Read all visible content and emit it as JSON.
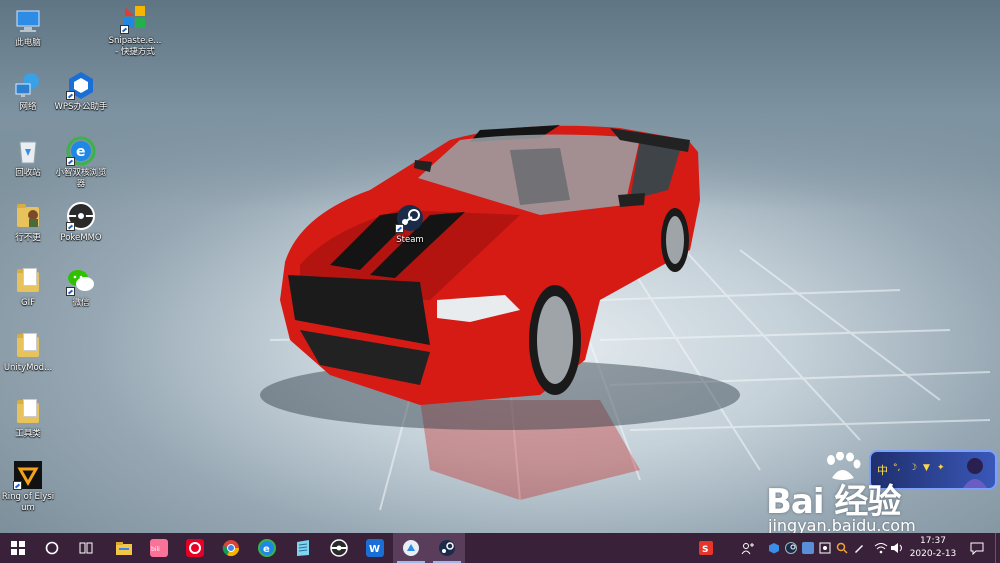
{
  "desktop": {
    "icons": [
      {
        "label": "此电脑",
        "icon": "computer-icon"
      },
      {
        "label": "Snipaste.e... - 快捷方式",
        "icon": "snipaste-icon"
      },
      {
        "label": "网络",
        "icon": "network-icon"
      },
      {
        "label": "WPS办公助手",
        "icon": "wps-assistant-icon"
      },
      {
        "label": "回收站",
        "icon": "recycle-bin-icon"
      },
      {
        "label": "小智双核浏览器",
        "icon": "browser-icon"
      },
      {
        "label": "行不更",
        "icon": "folder-icon"
      },
      {
        "label": "PokeMMO",
        "icon": "pokemmo-icon"
      },
      {
        "label": "GIF",
        "icon": "folder-icon"
      },
      {
        "label": "微信",
        "icon": "wechat-icon"
      },
      {
        "label": "UnityMod...",
        "icon": "folder-icon"
      },
      {
        "label": "Steam",
        "icon": "steam-icon"
      },
      {
        "label": "工具类",
        "icon": "folder-icon"
      },
      {
        "label": "Ring of Elysium",
        "icon": "ring-of-elysium-icon"
      }
    ]
  },
  "taskbar": {
    "apps": [
      {
        "icon": "start-icon"
      },
      {
        "icon": "cortana-search-icon"
      },
      {
        "icon": "task-view-icon"
      },
      {
        "icon": "file-explorer-icon"
      },
      {
        "icon": "bilibili-icon"
      },
      {
        "icon": "netease-music-icon"
      },
      {
        "icon": "chrome-icon"
      },
      {
        "icon": "browser-icon"
      },
      {
        "icon": "notepad-icon"
      },
      {
        "icon": "pokemmo-icon"
      },
      {
        "icon": "wps-icon"
      },
      {
        "icon": "app-icon"
      },
      {
        "icon": "steam-icon"
      }
    ],
    "tray": [
      {
        "icon": "sogou-ime-icon"
      },
      {
        "icon": "people-icon"
      },
      {
        "icon": "box-icon"
      },
      {
        "icon": "steam-tray-icon"
      },
      {
        "icon": "app-tray-icon"
      },
      {
        "icon": "gear-tray-icon"
      },
      {
        "icon": "search-tray-icon"
      },
      {
        "icon": "edit-tray-icon"
      },
      {
        "icon": "wifi-icon"
      },
      {
        "icon": "volume-icon"
      }
    ],
    "clock": {
      "time": "17:37",
      "date": "2020-2-13"
    },
    "notification": {
      "icon": "notification-icon"
    }
  },
  "ime_widget": {
    "lang": "中"
  },
  "watermark": {
    "logo": "Bai 经验",
    "url": "jingyan.baidu.com"
  },
  "colors": {
    "taskbar": "#3a213a",
    "car": "#d61a14",
    "accent": "#9fb8e8"
  }
}
